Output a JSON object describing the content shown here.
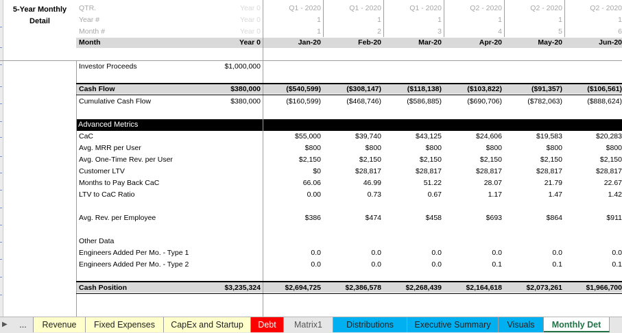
{
  "sheet_title": "5-Year Monthly\nDetail",
  "header_rows": {
    "qtr": [
      "QTR.",
      "Year 0",
      "Q1 - 2020",
      "Q1 - 2020",
      "Q1 - 2020",
      "Q2 - 2020",
      "Q2 - 2020",
      "Q2 - 2020"
    ],
    "year": [
      "Year #",
      "Year 0",
      "1",
      "1",
      "1",
      "1",
      "1",
      "1"
    ],
    "month_num": [
      "Month #",
      "Year 0",
      "1",
      "2",
      "3",
      "4",
      "5",
      "6"
    ],
    "month": [
      "Month",
      "Year 0",
      "Jan-20",
      "Feb-20",
      "Mar-20",
      "Apr-20",
      "May-20",
      "Jun-20"
    ]
  },
  "rows": {
    "investor": [
      "Investor Proceeds",
      "$1,000,000",
      "",
      "",
      "",
      "",
      "",
      ""
    ],
    "cash_flow": [
      "Cash Flow",
      "$380,000",
      "($540,599)",
      "($308,147)",
      "($118,138)",
      "($103,822)",
      "($91,357)",
      "($106,561)"
    ],
    "cum_cash_flow": [
      "Cumulative Cash Flow",
      "$380,000",
      "($160,599)",
      "($468,746)",
      "($586,885)",
      "($690,706)",
      "($782,063)",
      "($888,624)"
    ],
    "adv_title": "Advanced Metrics",
    "cac": [
      "CaC",
      "",
      "$55,000",
      "$39,740",
      "$43,125",
      "$24,606",
      "$19,583",
      "$20,283"
    ],
    "mrr": [
      "Avg. MRR per User",
      "",
      "$800",
      "$800",
      "$800",
      "$800",
      "$800",
      "$800"
    ],
    "onetime": [
      "Avg. One-Time Rev. per User",
      "",
      "$2,150",
      "$2,150",
      "$2,150",
      "$2,150",
      "$2,150",
      "$2,150"
    ],
    "ltv": [
      "Customer LTV",
      "",
      "$0",
      "$28,817",
      "$28,817",
      "$28,817",
      "$28,817",
      "$28,817"
    ],
    "payback": [
      "Months to Pay Back CaC",
      "",
      "66.06",
      "46.99",
      "51.22",
      "28.07",
      "21.79",
      "22.67"
    ],
    "ltv_cac": [
      "LTV to CaC Ratio",
      "",
      "0.00",
      "0.73",
      "0.67",
      "1.17",
      "1.47",
      "1.42"
    ],
    "rev_emp": [
      "Avg. Rev. per Employee",
      "",
      "$386",
      "$474",
      "$458",
      "$693",
      "$864",
      "$911"
    ],
    "other_title": "Other Data",
    "eng1": [
      "Engineers Added Per Mo. - Type 1",
      "",
      "0.0",
      "0.0",
      "0.0",
      "0.0",
      "0.0",
      "0.0"
    ],
    "eng2": [
      "Engineers Added Per Mo. - Type 2",
      "",
      "0.0",
      "0.0",
      "0.0",
      "0.1",
      "0.1",
      "0.1"
    ],
    "cash_pos": [
      "Cash Position",
      "$3,235,324",
      "$2,694,725",
      "$2,386,578",
      "$2,268,439",
      "$2,164,618",
      "$2,073,261",
      "$1,966,700"
    ]
  },
  "tabs": [
    {
      "label": "...",
      "bg": "#e6e6e6",
      "fg": "#222222"
    },
    {
      "label": "Revenue",
      "bg": "#ffffcc",
      "fg": "#222222"
    },
    {
      "label": "Fixed Expenses",
      "bg": "#ffffcc",
      "fg": "#222222"
    },
    {
      "label": "CapEx and Startup",
      "bg": "#ffffcc",
      "fg": "#222222"
    },
    {
      "label": "Debt",
      "bg": "#ff0000",
      "fg": "#ffffff"
    },
    {
      "label": "Matrix1",
      "bg": "#e6e6e6",
      "fg": "#555555"
    },
    {
      "label": "Distributions",
      "bg": "#00b0f0",
      "fg": "#222222"
    },
    {
      "label": "Executive Summary",
      "bg": "#00b0f0",
      "fg": "#222222"
    },
    {
      "label": "Visuals",
      "bg": "#00b0f0",
      "fg": "#222222"
    },
    {
      "label": "Monthly Det",
      "bg": "#ffffff",
      "fg": "#217346",
      "active": true
    }
  ],
  "colors": {
    "accent": "#217346",
    "header_band": "#d9d9d9",
    "black_band": "#000000"
  },
  "icons": {
    "scroll_right": "triangle-right-icon"
  }
}
